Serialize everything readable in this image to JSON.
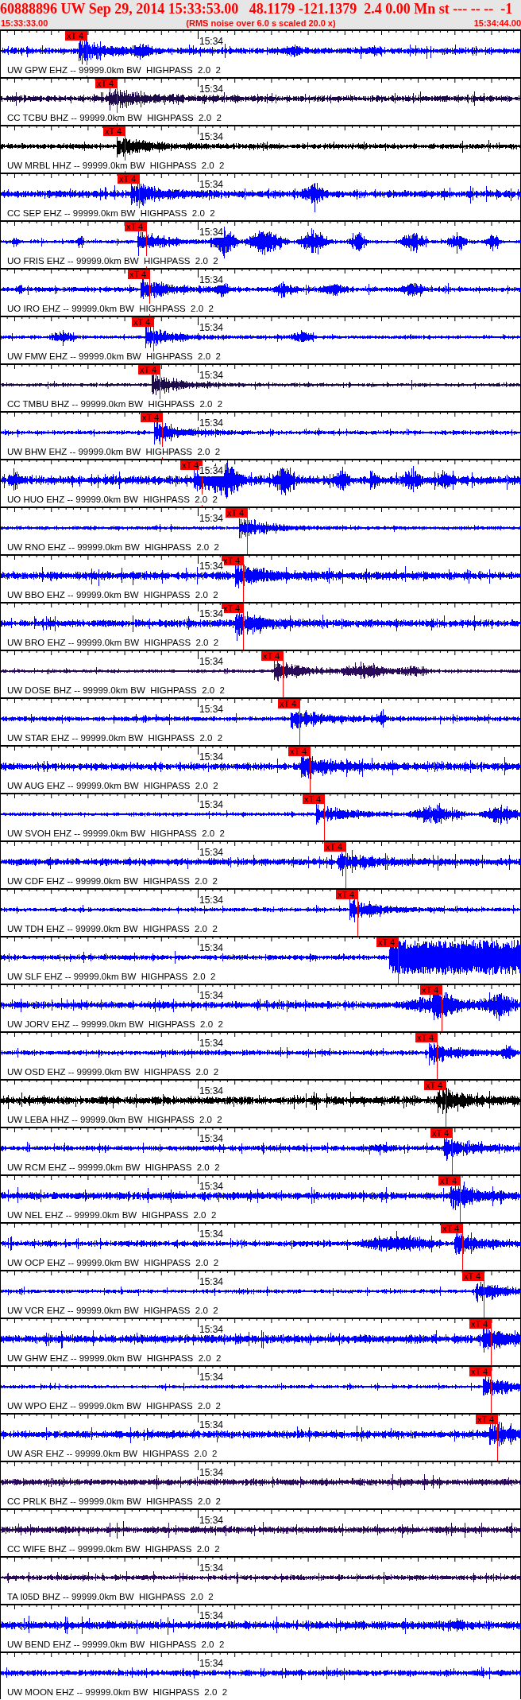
{
  "header": {
    "title": "60888896 UW Sep 29, 2014 15:33:53.00   48.1179 -121.1379  2.4 0.00 Mn st --- -- --  -1",
    "start_time": "15:33:33.00",
    "note": "(RMS noise over 6.0 s scaled 20.0 x)",
    "end_time": "15:34:44.00"
  },
  "traces": [
    {
      "label": "UW GPW EHZ -- 99999.0km BW  HIGHPASS  2.0  2",
      "tick_label": "15:34",
      "color": "#0000ff",
      "pick": {
        "label": "xT 4",
        "level": 0.168
      }
    },
    {
      "label": "CC TCBU BHZ -- 99999.0km BW  HIGHPASS  2.0  2",
      "tick_label": "15:34",
      "color": "#1c0a4a",
      "pick": {
        "label": "xT 4",
        "level": 0.226
      }
    },
    {
      "label": "UW MRBL HHZ -- 99999.0km BW  HIGHPASS  2.0  2",
      "tick_label": "15:34",
      "color": "#000000",
      "pick": {
        "label": "xT 4",
        "level": 0.241
      }
    },
    {
      "label": "CC SEP EHZ -- 99999.0km BW  HIGHPASS  2.0  2",
      "tick_label": "15:34",
      "color": "#0000ff",
      "pick": {
        "label": "xT 4",
        "level": 0.268
      }
    },
    {
      "label": "UO FRIS EHZ -- 99999.0km BW  HIGHPASS  2.0  2",
      "tick_label": "15:34",
      "color": "#0000ff",
      "pick": {
        "label": "xT 4",
        "level": 0.282
      }
    },
    {
      "label": "UO IRO EHZ -- 99999.0km BW  HIGHPASS  2.0  2",
      "tick_label": "15:34",
      "color": "#0000ff",
      "pick": {
        "label": "xT 4",
        "level": 0.288
      }
    },
    {
      "label": "UW FMW EHZ -- 99999.0km BW  HIGHPASS  2.0  2",
      "tick_label": "15:34",
      "color": "#0000ff",
      "pick": {
        "label": "xT 4",
        "level": 0.296
      }
    },
    {
      "label": "CC TMBU BHZ -- 99999.0km BW  HIGHPASS  2.0  2",
      "tick_label": "15:34",
      "color": "#1c0a4a",
      "pick": {
        "label": "xT 4",
        "level": 0.308
      }
    },
    {
      "label": "UW BHW EHZ -- 99999.0km BW  HIGHPASS  2.0  2",
      "tick_label": "15:34",
      "color": "#0000ff",
      "pick": {
        "label": "xT 4",
        "level": 0.313
      }
    },
    {
      "label": "UO HUO EHZ -- 99999.0km BW  HIGHPASS  2.0  2",
      "tick_label": "15:34",
      "color": "#0000ff",
      "pick": {
        "label": "xT 4",
        "level": 0.389
      }
    },
    {
      "label": "UW RNO EHZ -- 99999.0km BW  HIGHPASS  2.0  2",
      "tick_label": "15:34",
      "color": "#0000ff",
      "pick": {
        "label": "xT 4",
        "level": 0.476
      }
    },
    {
      "label": "UW BBO EHZ -- 99999.0km BW  HIGHPASS  2.0  2",
      "tick_label": "15:34",
      "color": "#0000ff",
      "pick": {
        "label": "xT 4",
        "level": 0.468
      }
    },
    {
      "label": "UW BRO EHZ -- 99999.0km BW  HIGHPASS  2.0  2",
      "tick_label": "15:34",
      "color": "#0000ff",
      "pick": {
        "label": "xT 4",
        "level": 0.468
      }
    },
    {
      "label": "UW DOSE BHZ -- 99999.0km BW  HIGHPASS  2.0  2",
      "tick_label": "15:34",
      "color": "#2a0a5a",
      "pick": {
        "label": "xT 4",
        "level": 0.544
      }
    },
    {
      "label": "UW STAR EHZ -- 99999.0km BW  HIGHPASS  2.0  2",
      "tick_label": "15:34",
      "color": "#0000ff",
      "pick": {
        "label": "xT 4",
        "level": 0.576
      }
    },
    {
      "label": "UW AUG EHZ -- 99999.0km BW  HIGHPASS  2.0  2",
      "tick_label": "15:34",
      "color": "#0000ff",
      "pick": {
        "label": "xT 4",
        "level": 0.596
      }
    },
    {
      "label": "UW SVOH EHZ -- 99999.0km BW  HIGHPASS  2.0  2",
      "tick_label": "15:34",
      "color": "#0000ff",
      "pick": {
        "label": "xT 4",
        "level": 0.624
      }
    },
    {
      "label": "UW CDF EHZ -- 99999.0km BW  HIGHPASS  2.0  2",
      "tick_label": "15:34",
      "color": "#0000ff",
      "pick": {
        "label": "xT 4",
        "level": 0.665
      }
    },
    {
      "label": "UW TDH EHZ -- 99999.0km BW  HIGHPASS  2.0  2",
      "tick_label": "15:34",
      "color": "#0000ff",
      "pick": {
        "label": "xT 4",
        "level": 0.688
      }
    },
    {
      "label": "UW SLF EHZ -- 99999.0km BW  HIGHPASS  2.0  2",
      "tick_label": "15:34",
      "color": "#0000ff",
      "pick": {
        "label": "xT 4",
        "level": 0.765
      }
    },
    {
      "label": "UW JORV EHZ -- 99999.0km BW  HIGHPASS  2.0  2",
      "tick_label": "15:34",
      "color": "#0000ff",
      "pick": {
        "label": "xT 4",
        "level": 0.849
      }
    },
    {
      "label": "UW OSD EHZ -- 99999.0km BW  HIGHPASS  2.0  2",
      "tick_label": "15:34",
      "color": "#0000ff",
      "pick": {
        "label": "xT 4",
        "level": 0.84
      }
    },
    {
      "label": "UW LEBA HHZ -- 99999.0km BW  HIGHPASS  2.0  2",
      "tick_label": "15:34",
      "color": "#000000",
      "pick": {
        "label": "xT 4",
        "level": 0.857
      }
    },
    {
      "label": "UW RCM EHZ -- 99999.0km BW  HIGHPASS  2.0  2",
      "tick_label": "15:34",
      "color": "#0000ff",
      "pick": {
        "label": "xT 4",
        "level": 0.869
      }
    },
    {
      "label": "UW NEL EHZ -- 99999.0km BW  HIGHPASS  2.0  2",
      "tick_label": "15:34",
      "color": "#0000ff",
      "pick": {
        "label": "xT 4",
        "level": 0.884
      }
    },
    {
      "label": "UW OCP EHZ -- 99999.0km BW  HIGHPASS  2.0  2",
      "tick_label": "15:34",
      "color": "#0000ff",
      "pick": {
        "label": "xT 4",
        "level": 0.889
      }
    },
    {
      "label": "UW VCR EHZ -- 99999.0km BW  HIGHPASS  2.0  2",
      "tick_label": "15:34",
      "color": "#0000ff",
      "pick": {
        "label": "xT 4",
        "level": 0.93
      }
    },
    {
      "label": "UW GHW EHZ -- 99999.0km BW  HIGHPASS  2.0  2",
      "tick_label": "15:34",
      "color": "#0000ff",
      "pick": {
        "label": "xT 4",
        "level": 0.944
      }
    },
    {
      "label": "UW WPO EHZ -- 99999.0km BW  HIGHPASS  2.0  2",
      "tick_label": "15:34",
      "color": "#0000ff",
      "pick": {
        "label": "xT 4",
        "level": 0.944
      }
    },
    {
      "label": "UW ASR EHZ -- 99999.0km BW  HIGHPASS  2.0  2",
      "tick_label": "15:34",
      "color": "#0000ff",
      "pick": {
        "label": "xT 4",
        "level": 0.956
      }
    },
    {
      "label": "CC PRLK BHZ -- 99999.0km BW  HIGHPASS  2.0  2",
      "tick_label": "15:34",
      "color": "#2a0a5a"
    },
    {
      "label": "CC WIFE BHZ -- 99999.0km BW  HIGHPASS  2.0  2",
      "tick_label": "15:34",
      "color": "#2a0a5a"
    },
    {
      "label": "TA I05D BHZ -- 99999.0km BW  HIGHPASS  2.0  2",
      "tick_label": "15:34",
      "color": "#2a0a5a"
    },
    {
      "label": "UW BEND EHZ -- 99999.0km BW  HIGHPASS  2.0  2",
      "tick_label": "15:34",
      "color": "#0000ff"
    },
    {
      "label": "UW MOON EHZ -- 99999.0km BW  HIGHPASS  2.0  2",
      "tick_label": "15:34",
      "color": "#0000ff"
    }
  ]
}
